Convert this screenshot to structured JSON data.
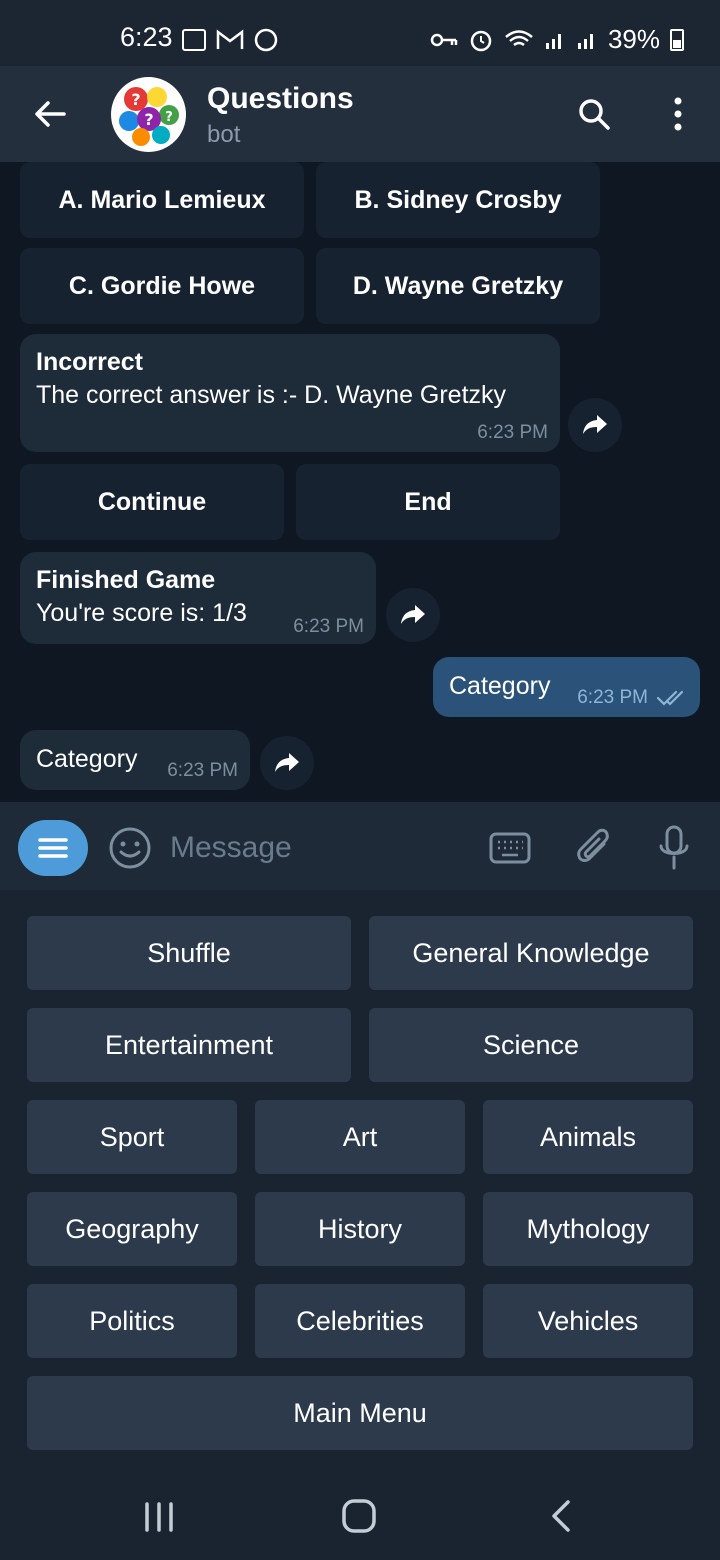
{
  "status_bar": {
    "time": "6:23",
    "battery": "39%"
  },
  "header": {
    "title": "Questions",
    "subtitle": "bot"
  },
  "inline_answers": [
    "A. Mario Lemieux",
    "B. Sidney Crosby",
    "C. Gordie Howe",
    "D. Wayne Gretzky"
  ],
  "messages": {
    "result": {
      "title": "Incorrect",
      "prefix": "The correct answer is :- ",
      "answer": "D. Wayne Gretzky",
      "time": "6:23 PM"
    },
    "inline_actions": [
      "Continue",
      "End"
    ],
    "finished": {
      "title": "Finished Game",
      "text": "You're score is: 1/3",
      "time": "6:23 PM"
    },
    "outgoing": {
      "text": "Category",
      "time": "6:23 PM"
    },
    "incoming_category": {
      "text": "Category",
      "time": "6:23 PM"
    }
  },
  "input": {
    "placeholder": "Message"
  },
  "keyboard": {
    "row1": [
      "Shuffle",
      "General Knowledge"
    ],
    "row2": [
      "Entertainment",
      "Science"
    ],
    "row3": [
      "Sport",
      "Art",
      "Animals"
    ],
    "row4": [
      "Geography",
      "History",
      "Mythology"
    ],
    "row5": [
      "Politics",
      "Celebrities",
      "Vehicles"
    ],
    "row6": [
      "Main Menu"
    ]
  },
  "colors": {
    "accent": "#4d9bd8",
    "outgoing_bubble": "#2b5278",
    "incoming_bubble": "#1e2c3a",
    "keyboard_button": "#2c3a4b"
  }
}
